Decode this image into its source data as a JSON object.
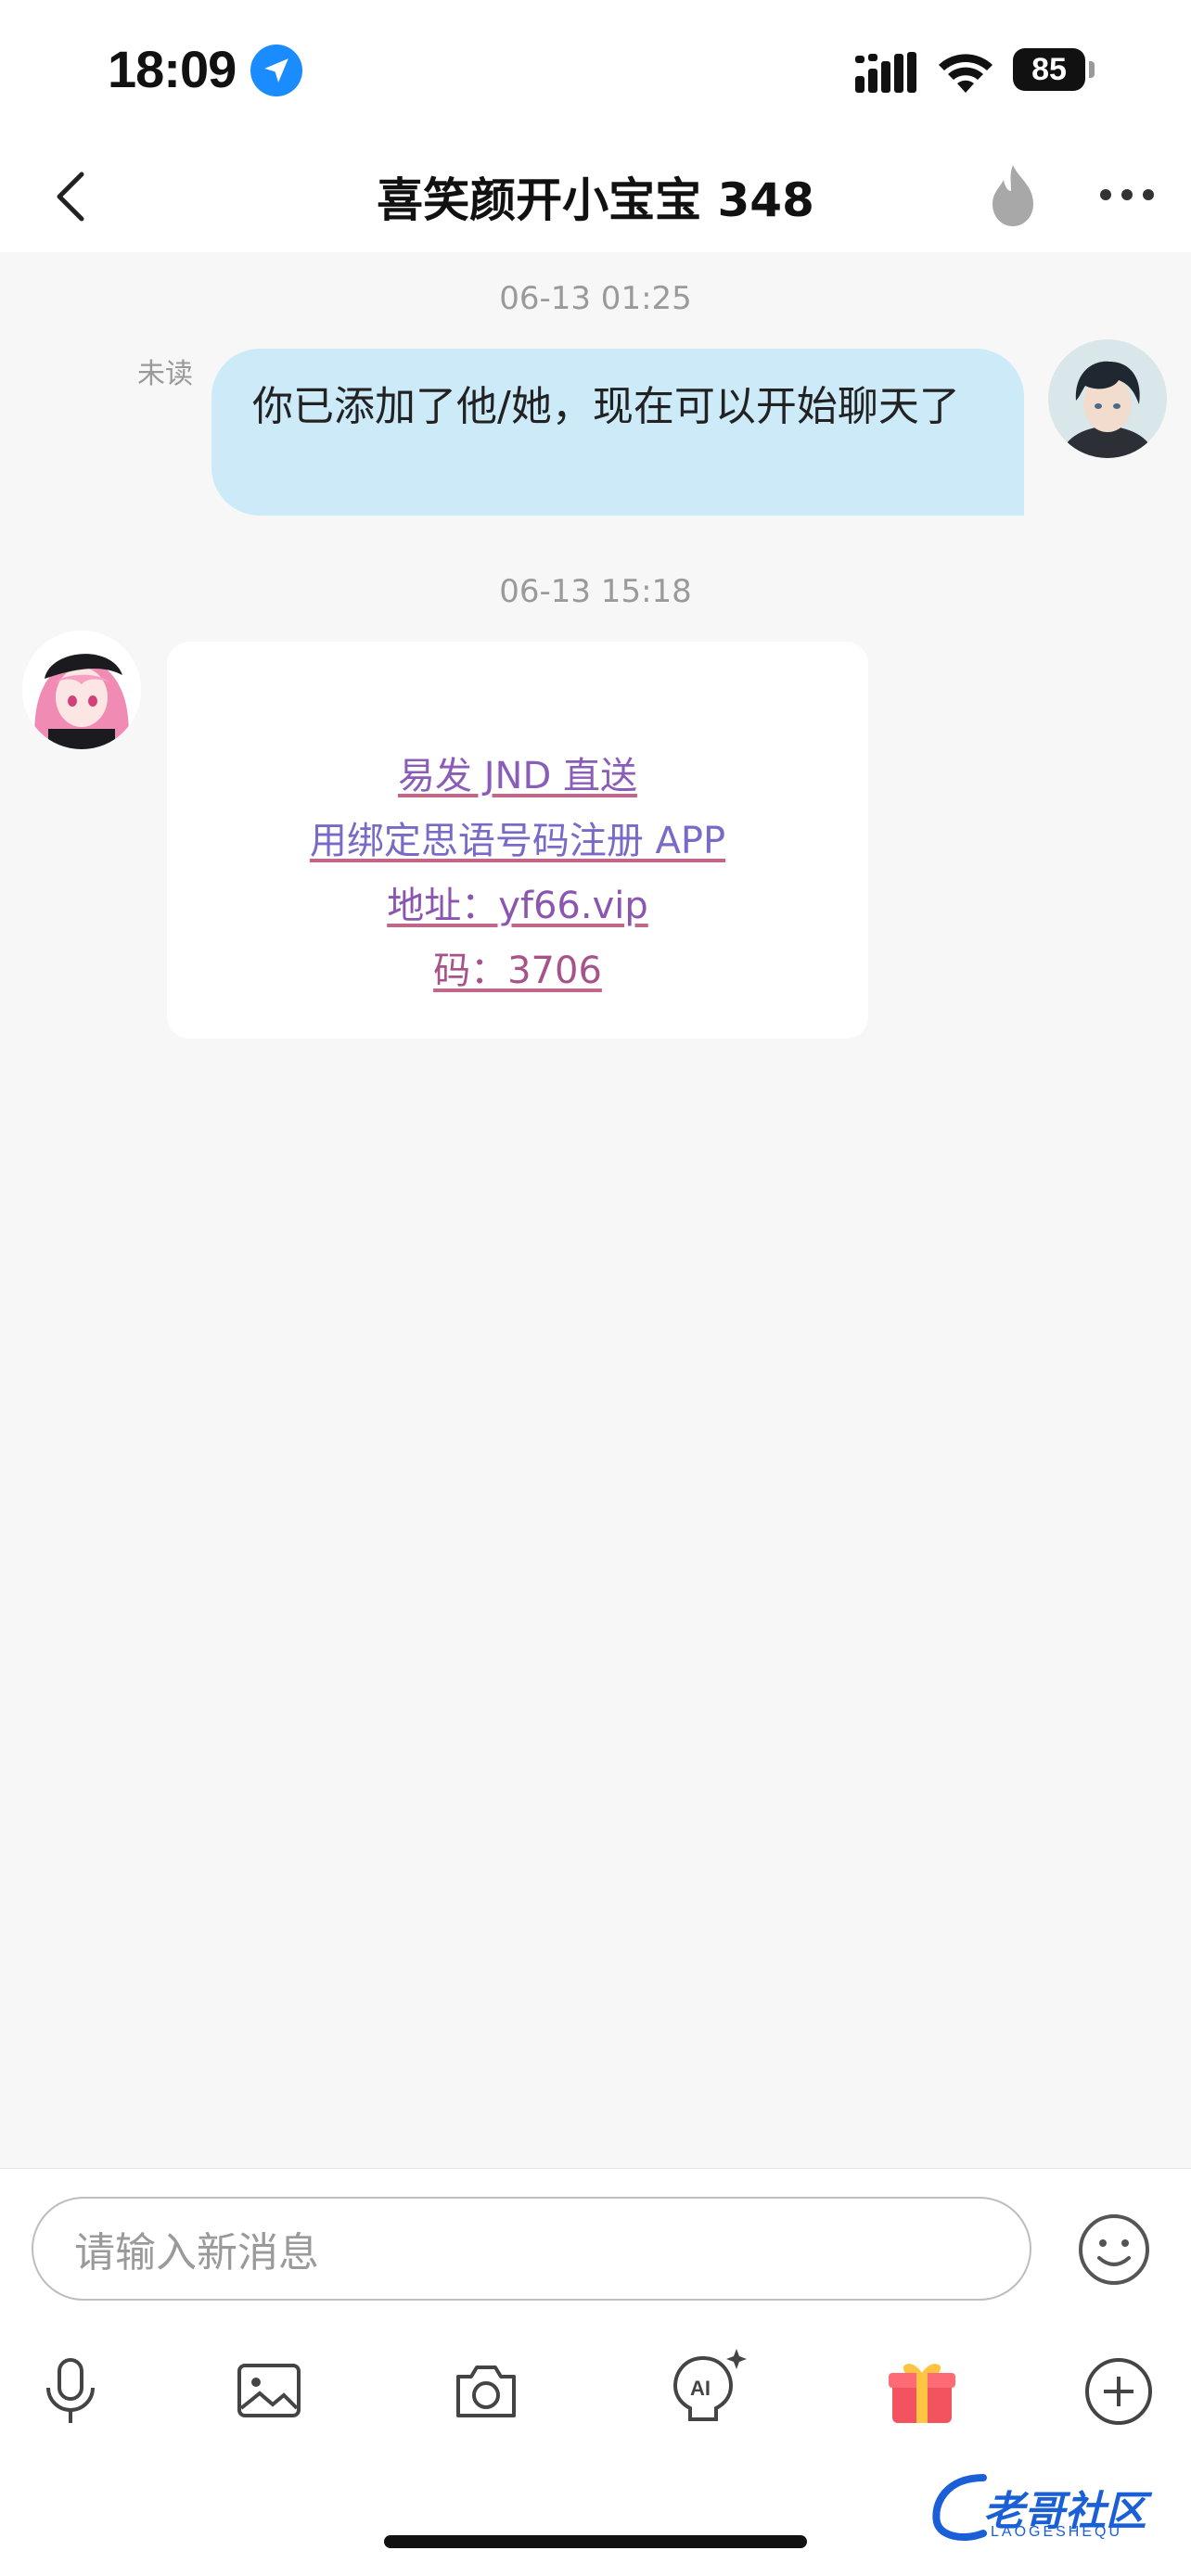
{
  "status_bar": {
    "time": "18:09",
    "battery": "85"
  },
  "header": {
    "title": "喜笑颜开小宝宝 348"
  },
  "messages": [
    {
      "timestamp": "06-13 01:25",
      "unread_label": "未读",
      "text": "你已添加了他/她，现在可以开始聊天了"
    },
    {
      "timestamp": "06-13 15:18",
      "card_lines": [
        "易发 JND 直送",
        "用绑定思语号码注册 APP",
        "地址：yf66.vip",
        "码：3706"
      ]
    }
  ],
  "composer": {
    "placeholder": "请输入新消息"
  },
  "watermark": {
    "text": "老哥社区",
    "sub": "LAOGESHEQU"
  },
  "colors": {
    "outgoing_bubble": "#cdeaf8",
    "accent_blue": "#1a8cff",
    "background": "#f7f7f7"
  }
}
